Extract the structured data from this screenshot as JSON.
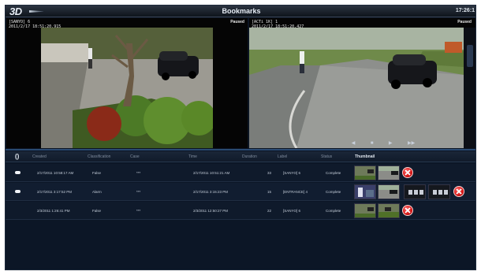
{
  "app": {
    "logo": "3D",
    "title": "Bookmarks",
    "clock": "17:26:1"
  },
  "video_1": {
    "camera": "[SANYO] 6",
    "timestamp": "2011/2/17  18:51:20.915",
    "status": "Paused"
  },
  "video_2": {
    "camera": "[ACTi 1K] 1",
    "timestamp": "2011/2/17  18:51:20.427",
    "status": "Paused"
  },
  "table": {
    "columns": [
      "Created",
      "Classification",
      "Case",
      "Time",
      "Duration",
      "Label",
      "Status",
      "Thumbnail"
    ],
    "rows": [
      {
        "created": "2/17/2011 10:58:17 AM",
        "classification": "False",
        "case": "***",
        "time": "2/17/2011 10:51:21 AM",
        "duration": "33",
        "label": "[SANYO] 6",
        "status": "Complete"
      },
      {
        "created": "2/17/2011 3:17:52 PM",
        "classification": "Alarm",
        "case": "***",
        "time": "2/17/2011 3:15:23 PM",
        "duration": "15",
        "label": "[ENTRANCE] 4",
        "status": "Complete"
      },
      {
        "created": "2/3/2011 1:26:41 PM",
        "classification": "False",
        "case": "***",
        "time": "2/3/2011 12:50:27 PM",
        "duration": "22",
        "label": "[SANYO] 6",
        "status": "Complete"
      }
    ]
  },
  "icons": {
    "refresh": "()",
    "delete": "delete-icon",
    "play_controls": [
      "◀",
      "■",
      "▶",
      "▶▶"
    ]
  },
  "colors": {
    "background": "#0b1422",
    "header": "#1a2638",
    "accent_blue": "#2a4a72",
    "delete_red": "#d41414"
  }
}
